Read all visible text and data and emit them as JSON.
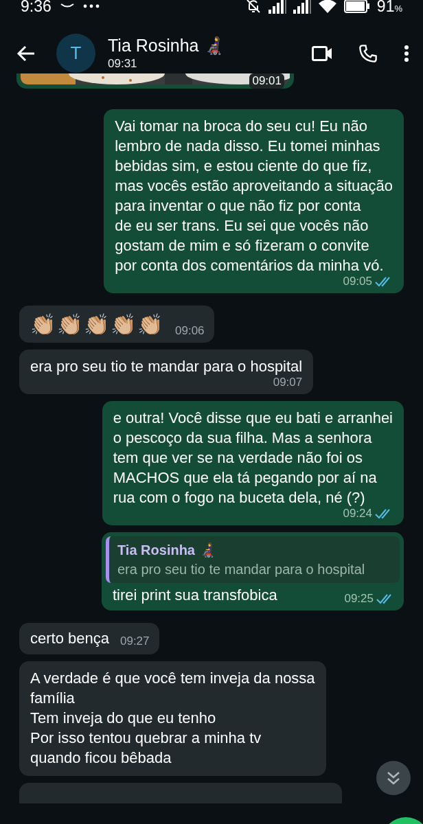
{
  "status_bar": {
    "time": "9:36",
    "battery": "91",
    "battery_unit": "%"
  },
  "header": {
    "avatar_letter": "T",
    "name": "Tia Rosinha 👩‍🦼",
    "last_seen": "09:31"
  },
  "messages": [
    {
      "kind": "picture",
      "outgoing": true,
      "time": "09:01"
    },
    {
      "kind": "text",
      "outgoing": true,
      "text": "Vai tomar na broca do seu cu! Eu não\nlembro de nada disso. Eu tomei minhas\nbebidas sim, e estou ciente do que fiz,\nmas vocês estão aproveitando a situação\npara inventar o que não fiz por conta\nde eu ser trans. Eu sei que vocês não\ngostam de mim e só fizeram o convite\npor conta dos comentários da minha vó.",
      "time": "09:05",
      "read": true
    },
    {
      "kind": "emoji",
      "outgoing": false,
      "text": "👏🏼👏🏼👏🏼👏🏼👏🏼",
      "time": "09:06"
    },
    {
      "kind": "text",
      "outgoing": false,
      "text": "era pro seu tio te mandar para o hospital",
      "time": "09:07"
    },
    {
      "kind": "text",
      "outgoing": true,
      "text": "e outra! Você disse que eu bati e arranhei\no pescoço da sua filha. Mas a senhora\ntem que ver se na verdade não foi os\nMACHOS que ela tá pegando por aí na\nrua com o fogo na buceta dela, né (?)",
      "time": "09:24",
      "read": true
    },
    {
      "kind": "reply",
      "outgoing": true,
      "quote_author": "Tia Rosinha 👩‍🦼",
      "quote_text": "era pro seu tio te mandar para o hospital",
      "text": "tirei print sua transfobica",
      "time": "09:25",
      "read": true
    },
    {
      "kind": "short",
      "outgoing": false,
      "text": "certo bença",
      "time": "09:27"
    },
    {
      "kind": "text",
      "outgoing": false,
      "text": "A verdade é que você tem inveja da nossa\nfamília\nTem inveja do que eu tenho\nPor isso tentou quebrar a minha tv\nquando ficou bêbada"
    }
  ]
}
